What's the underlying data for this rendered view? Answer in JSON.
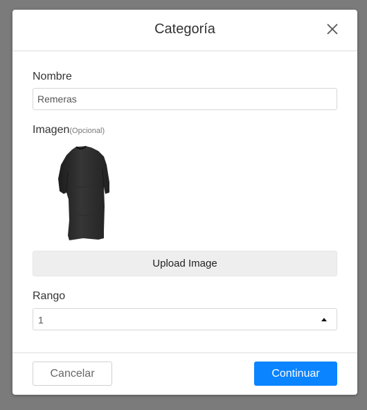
{
  "modal": {
    "title": "Categoría"
  },
  "form": {
    "name_label": "Nombre",
    "name_value": "Remeras",
    "image_label": "Imagen",
    "image_optional": "(Opcional)",
    "image_subject": "black-tshirt-image",
    "upload_label": "Upload Image",
    "rank_label": "Rango",
    "rank_value": "1"
  },
  "footer": {
    "cancel_label": "Cancelar",
    "continue_label": "Continuar"
  },
  "colors": {
    "primary": "#0a84ff",
    "backdrop": "#7b7b7b",
    "upload_bg": "#eeeeee"
  },
  "icons": {
    "close": "close-icon",
    "select_arrow": "caret-up-icon"
  }
}
